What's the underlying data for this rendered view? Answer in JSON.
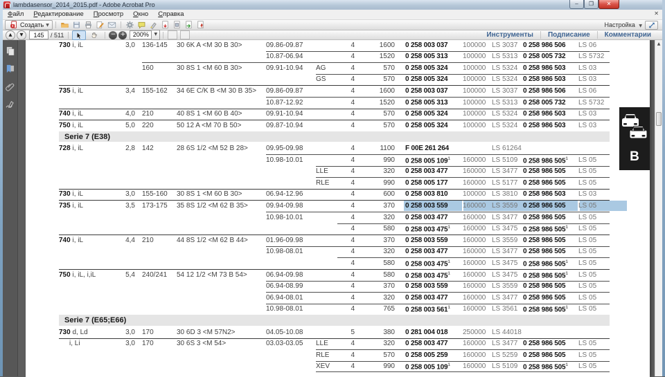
{
  "window": {
    "title": "lambdasensor_2014_2015.pdf - Adobe Acrobat Pro",
    "minimize": "–",
    "maximize": "❐",
    "close": "✕",
    "doc_close": "✕"
  },
  "menu": {
    "items": [
      "Файл",
      "Редактирование",
      "Просмотр",
      "Окно",
      "Справка"
    ]
  },
  "toolbar": {
    "create_label": "Создать",
    "settings_label": "Настройка",
    "page_current": "145",
    "page_total": "/ 511",
    "zoom_value": "200%"
  },
  "task_panels": {
    "tools": "Инструменты",
    "signing": "Подписание",
    "comments": "Комментарии"
  },
  "scroll": {
    "up_arrow": "▲"
  },
  "marker": {
    "letter": "B"
  },
  "colors": {
    "selection": "#aac9e2",
    "section_band": "#e5e5e5",
    "link_blue": "#3f6492"
  },
  "footnote_mark": "1",
  "table": {
    "rows": [
      {
        "m_b": "730",
        "m": " i, iL",
        "d": "3,0",
        "p": "136-145",
        "e": "30 6K A <M 30 B 30>",
        "dt": "09.86-09.87",
        "q": "4",
        "val": "1600",
        "p1": "0 258 003 037",
        "iv": "100000",
        "l1": "LS 3037",
        "p2": "0 258 986 506",
        "l2": "LS 06",
        "rule": "none"
      },
      {
        "dt": "10.87-06.94",
        "q": "4",
        "val": "1520",
        "p1": "0 258 005 313",
        "iv": "100000",
        "l1": "LS 5313",
        "p2": "0 258 005 732",
        "l2": "LS 5732",
        "rule": "date"
      },
      {
        "p": "160",
        "e": "30 8S 1 <M 60 B 30>",
        "dt": "09.91-10.94",
        "v": "AG",
        "q": "4",
        "val": "570",
        "p1": "0 258 005 324",
        "iv": "100000",
        "l1": "LS 5324",
        "p2": "0 258 986 503",
        "l2": "LS 03",
        "rule": "power"
      },
      {
        "v": "GS",
        "q": "4",
        "val": "570",
        "p1": "0 258 005 324",
        "iv": "100000",
        "l1": "LS 5324",
        "p2": "0 258 986 503",
        "l2": "LS 03",
        "rule": "variant"
      },
      {
        "m_b": "735",
        "m": " i, iL",
        "d": "3,4",
        "p": "155-162",
        "e": "34 6E C/K B <M 30 B 35>",
        "dt": "09.86-09.87",
        "q": "4",
        "val": "1600",
        "p1": "0 258 003 037",
        "iv": "100000",
        "l1": "LS 3037",
        "p2": "0 258 986 506",
        "l2": "LS 06",
        "rule": "full"
      },
      {
        "dt": "10.87-12.92",
        "q": "4",
        "val": "1520",
        "p1": "0 258 005 313",
        "iv": "100000",
        "l1": "LS 5313",
        "p2": "0 258 005 732",
        "l2": "LS 5732",
        "rule": "date"
      },
      {
        "m_b": "740",
        "m": " i, iL",
        "d": "4,0",
        "p": "210",
        "e": "40 8S 1 <M 60 B 40>",
        "dt": "09.91-10.94",
        "q": "4",
        "val": "570",
        "p1": "0 258 005 324",
        "iv": "100000",
        "l1": "LS 5324",
        "p2": "0 258 986 503",
        "l2": "LS 03",
        "rule": "full"
      },
      {
        "m_b": "750",
        "m": " i, iL",
        "d": "5,0",
        "p": "220",
        "e": "50 12 A <M 70 B 50>",
        "dt": "09.87-10.94",
        "q": "4",
        "val": "570",
        "p1": "0 258 005 324",
        "iv": "100000",
        "l1": "LS 5324",
        "p2": "0 258 986 503",
        "l2": "LS 03",
        "rule": "full"
      },
      {
        "sec": "Serie 7 (E38)",
        "rule": "full"
      },
      {
        "m_b": "728",
        "m": " i, iL",
        "d": "2,8",
        "p": "142",
        "e": "28 6S 1/2 <M 52 B 28>",
        "dt": "09.95-09.98",
        "q": "4",
        "val": "1100",
        "p1": "F 00E 261 264",
        "l1": "LS 61264",
        "rule": "none"
      },
      {
        "dt": "10.98-10.01",
        "q": "4",
        "val": "990",
        "p1": "0 258 005 109",
        "s1": true,
        "iv": "160000",
        "l1": "LS 5109",
        "p2": "0 258 986 505",
        "s2": true,
        "l2": "LS 05",
        "rule": "date"
      },
      {
        "v": "LLE",
        "q": "4",
        "val": "320",
        "p1": "0 258 003 477",
        "iv": "160000",
        "l1": "LS 3477",
        "p2": "0 258 986 505",
        "l2": "LS 05",
        "rule": "variant"
      },
      {
        "v": "RLE",
        "q": "4",
        "val": "990",
        "p1": "0 258 005 177",
        "iv": "160000",
        "l1": "LS 5177",
        "p2": "0 258 986 505",
        "l2": "LS 05",
        "rule": "variant"
      },
      {
        "m_b": "730",
        "m": " i, iL",
        "d": "3,0",
        "p": "155-160",
        "e": "30 8S 1 <M 60 B 30>",
        "dt": "06.94-12.96",
        "q": "4",
        "val": "600",
        "p1": "0 258 003 810",
        "iv": "100000",
        "l1": "LS 3810",
        "p2": "0 258 986 503",
        "l2": "LS 03",
        "rule": "full"
      },
      {
        "m_b": "735",
        "m": " i, iL",
        "d": "3,5",
        "p": "173-175",
        "e": "35 8S 1/2 <M 62 B 35>",
        "dt": "09.94-09.98",
        "q": "4",
        "val": "370",
        "p1": "0 258 003 559",
        "iv": "160000",
        "l1": "LS 3559",
        "p2": "0 258 986 505",
        "l2": "LS 05",
        "rule": "full",
        "hl": true
      },
      {
        "dt": "10.98-10.01",
        "q": "4",
        "val": "320",
        "p1": "0 258 003 477",
        "iv": "160000",
        "l1": "LS 3477",
        "p2": "0 258 986 505",
        "l2": "LS 05",
        "rule": "date"
      },
      {
        "q": "4",
        "val": "580",
        "p1": "0 258 003 475",
        "s1": true,
        "iv": "160000",
        "l1": "LS 3475",
        "p2": "0 258 986 505",
        "s2": true,
        "l2": "LS 05",
        "rule": "qty"
      },
      {
        "m_b": "740",
        "m": " i, iL",
        "d": "4,4",
        "p": "210",
        "e": "44 8S 1/2 <M 62 B 44>",
        "dt": "01.96-09.98",
        "q": "4",
        "val": "370",
        "p1": "0 258 003 559",
        "iv": "160000",
        "l1": "LS 3559",
        "p2": "0 258 986 505",
        "l2": "LS 05",
        "rule": "full"
      },
      {
        "dt": "10.98-08.01",
        "q": "4",
        "val": "320",
        "p1": "0 258 003 477",
        "iv": "160000",
        "l1": "LS 3477",
        "p2": "0 258 986 505",
        "l2": "LS 05",
        "rule": "date"
      },
      {
        "q": "4",
        "val": "580",
        "p1": "0 258 003 475",
        "s1": true,
        "iv": "160000",
        "l1": "LS 3475",
        "p2": "0 258 986 505",
        "s2": true,
        "l2": "LS 05",
        "rule": "qty"
      },
      {
        "m_b": "750",
        "m": " i, iL, i,iL",
        "d": "5,4",
        "p": "240/241",
        "e": "54 12 1/2 <M 73 B 54>",
        "dt": "06.94-09.98",
        "q": "4",
        "val": "580",
        "p1": "0 258 003 475",
        "s1": true,
        "iv": "160000",
        "l1": "LS 3475",
        "p2": "0 258 986 505",
        "s2": true,
        "l2": "LS 05",
        "rule": "full"
      },
      {
        "dt": "06.94-08.99",
        "q": "4",
        "val": "370",
        "p1": "0 258 003 559",
        "iv": "160000",
        "l1": "LS 3559",
        "p2": "0 258 986 505",
        "l2": "LS 05",
        "rule": "date"
      },
      {
        "dt": "06.94-08.01",
        "q": "4",
        "val": "320",
        "p1": "0 258 003 477",
        "iv": "160000",
        "l1": "LS 3477",
        "p2": "0 258 986 505",
        "l2": "LS 05",
        "rule": "date"
      },
      {
        "dt": "10.98-08.01",
        "q": "4",
        "val": "765",
        "p1": "0 258 003 561",
        "s1": true,
        "iv": "160000",
        "l1": "LS 3561",
        "p2": "0 258 986 505",
        "s2": true,
        "l2": "LS 05",
        "rule": "date"
      },
      {
        "sec": "Serie 7 (E65;E66)",
        "rule": "full"
      },
      {
        "m_b": "730",
        "m": " d, Ld",
        "d": "3,0",
        "p": "170",
        "e": "30 6D 3 <M 57N2>",
        "dt": "04.05-10.08",
        "q": "5",
        "val": "380",
        "p1": "0 281 004 018",
        "iv": "250000",
        "l1": "LS 44018",
        "rule": "none"
      },
      {
        "m": "i, Li",
        "m_indent": true,
        "d": "3,0",
        "p": "170",
        "e": "30 6S 3 <M 54>",
        "dt": "03.03-03.05",
        "v": "LLE",
        "q": "4",
        "val": "320",
        "p1": "0 258 003 477",
        "iv": "160000",
        "l1": "LS 3477",
        "p2": "0 258 986 505",
        "l2": "LS 05",
        "rule": "full"
      },
      {
        "v": "RLE",
        "q": "4",
        "val": "570",
        "p1": "0 258 005 259",
        "iv": "160000",
        "l1": "LS 5259",
        "p2": "0 258 986 505",
        "l2": "LS 05",
        "rule": "variant"
      },
      {
        "v": "XEV",
        "q": "4",
        "val": "990",
        "p1": "0 258 005 109",
        "s1": true,
        "iv": "160000",
        "l1": "LS 5109",
        "p2": "0 258 986 505",
        "s2": true,
        "l2": "LS 05",
        "rule": "variant",
        "bottom": "variant"
      }
    ]
  }
}
